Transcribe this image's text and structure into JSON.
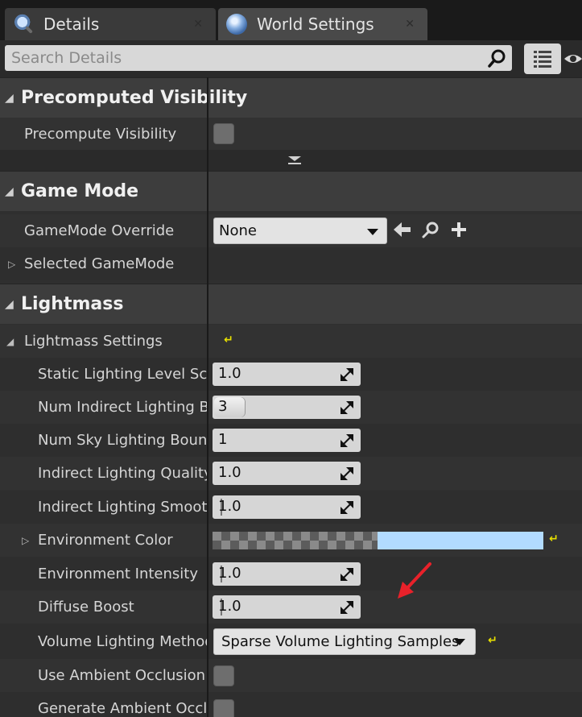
{
  "tabs": [
    {
      "label": "Details",
      "icon": "magnifier-icon"
    },
    {
      "label": "World Settings",
      "icon": "globe-icon"
    }
  ],
  "tab_close_glyph": "✕",
  "search": {
    "placeholder": "Search Details"
  },
  "categories": {
    "precomputed_visibility": {
      "title": "Precomputed Visibility",
      "precompute_visibility_label": "Precompute Visibility"
    },
    "game_mode": {
      "title": "Game Mode",
      "gamemode_override_label": "GameMode Override",
      "gamemode_override_value": "None",
      "selected_gamemode_label": "Selected GameMode"
    },
    "lightmass": {
      "title": "Lightmass",
      "settings_label": "Lightmass Settings",
      "properties": {
        "static_lighting_level_scale": {
          "label": "Static Lighting Level Scale",
          "value": "1.0"
        },
        "num_indirect_lighting_bounces": {
          "label": "Num Indirect Lighting Bounces",
          "value": "3"
        },
        "num_sky_lighting_bounces": {
          "label": "Num Sky Lighting Bounces",
          "value": "1"
        },
        "indirect_lighting_quality": {
          "label": "Indirect Lighting Quality",
          "value": "1.0"
        },
        "indirect_lighting_smoothness": {
          "label": "Indirect Lighting Smoothness",
          "value": "1.0"
        },
        "environment_color": {
          "label": "Environment Color",
          "color": "#b2dbff"
        },
        "environment_intensity": {
          "label": "Environment Intensity",
          "value": "1.0"
        },
        "diffuse_boost": {
          "label": "Diffuse Boost",
          "value": "1.0"
        },
        "volume_lighting_method": {
          "label": "Volume Lighting Method",
          "value": "Sparse Volume Lighting Samples"
        },
        "use_ambient_occlusion": {
          "label": "Use Ambient Occlusion"
        },
        "generate_ambient_occlusion": {
          "label": "Generate Ambient Occlusion"
        }
      }
    }
  },
  "colors": {
    "annotation_arrow": "#e8212a",
    "reset_to_default": "#e8e000"
  }
}
